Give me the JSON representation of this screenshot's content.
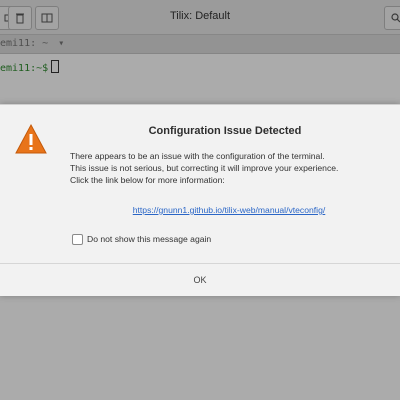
{
  "window": {
    "title": "Tilix: Default",
    "tab_label": "emi11: ~",
    "tab_indicator": "▾"
  },
  "terminal": {
    "prompt": "emi11:~$"
  },
  "toolbar": {
    "left_icons": [
      "new-session-icon",
      "split-icon"
    ],
    "right_icons": [
      "search-icon"
    ]
  },
  "dialog": {
    "title": "Configuration Issue Detected",
    "body_lines": [
      "There appears to be an issue with the configuration of the terminal.",
      "This issue is not serious, but correcting it will improve your experience.",
      "Click the link below for more information:"
    ],
    "link_text": "https://gnunn1.github.io/tilix-web/manual/vteconfig/",
    "checkbox_label": "Do not show this message again",
    "checkbox_checked": false,
    "ok_label": "OK",
    "icon": "warning-icon",
    "accent_color": "#e8741a"
  }
}
